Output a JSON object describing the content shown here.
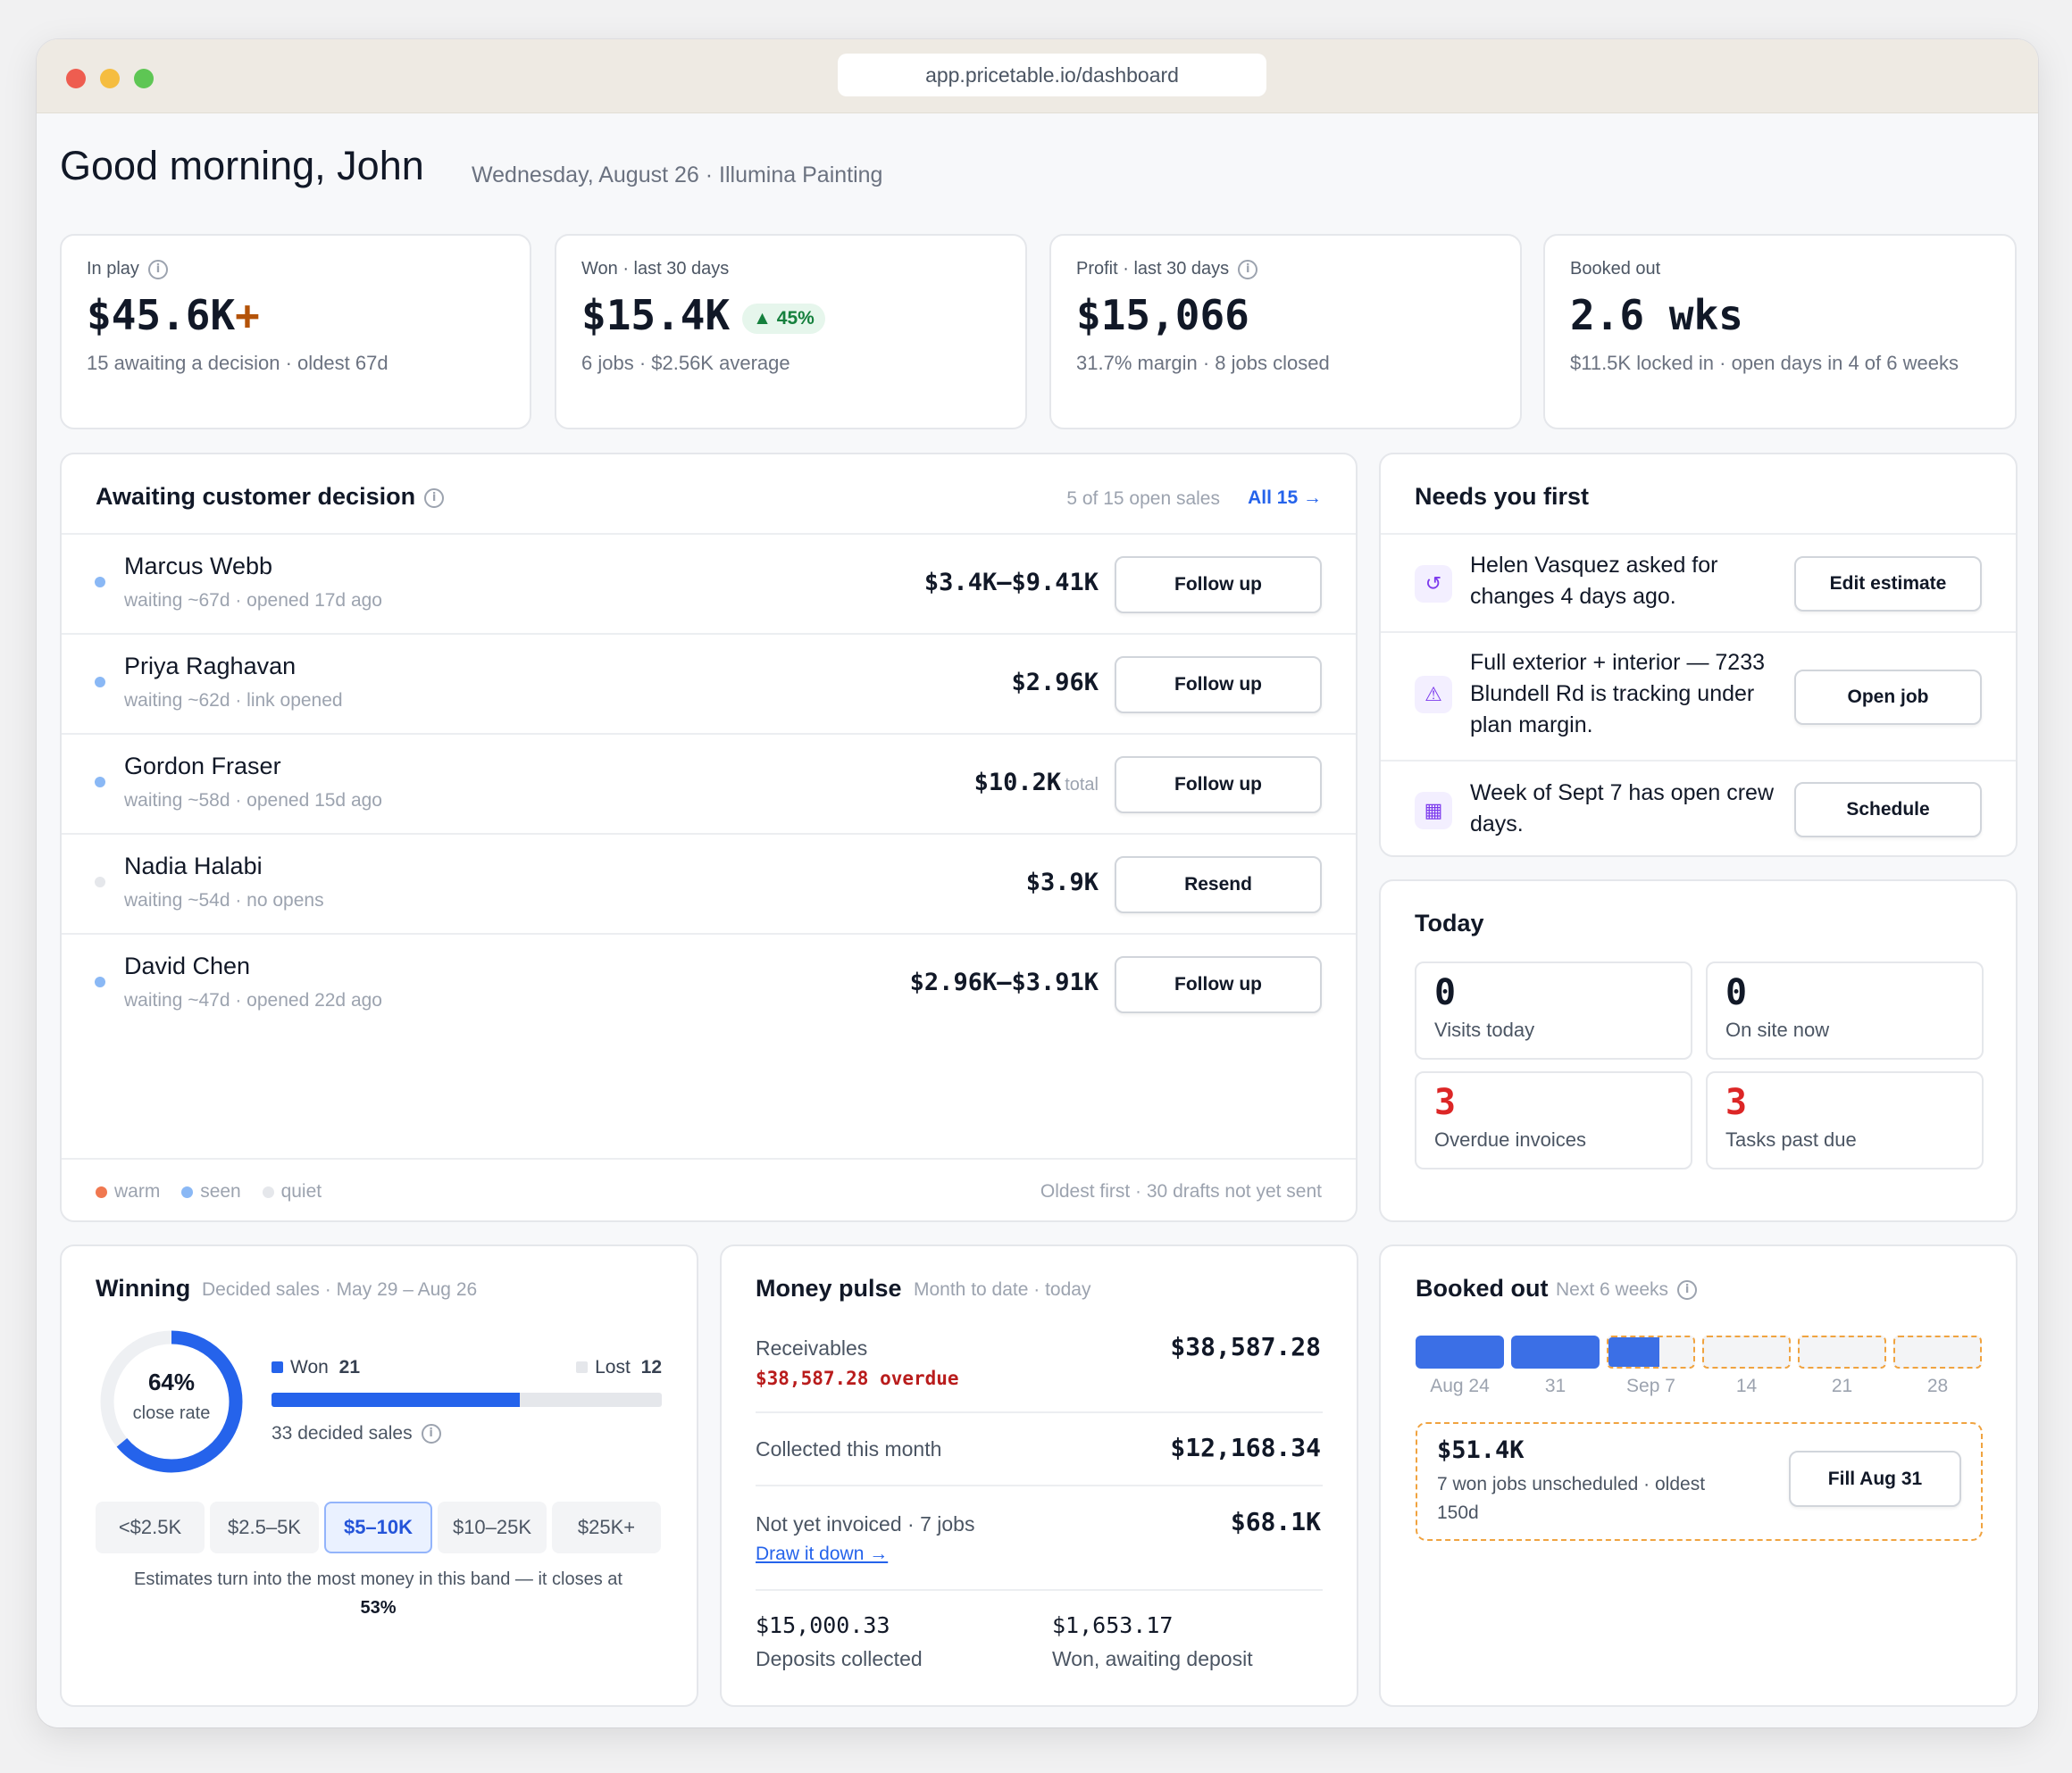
{
  "browser": {
    "url": "app.pricetable.io/dashboard"
  },
  "header": {
    "greeting": "Good morning, John",
    "subtitle": "Wednesday, August 26 · Illumina Painting"
  },
  "stats": {
    "in_play": {
      "label": "In play",
      "value": "$45.6K",
      "plus": "+",
      "sub": "15 awaiting a decision · oldest 67d"
    },
    "won": {
      "label": "Won · last 30 days",
      "value": "$15.4K",
      "badge": "▲ 45%",
      "sub": "6 jobs · $2.56K average"
    },
    "profit": {
      "label": "Profit · last 30 days",
      "value": "$15,066",
      "sub": "31.7% margin · 8 jobs closed"
    },
    "booked": {
      "label": "Booked out",
      "value": "2.6 wks",
      "sub": "$11.5K locked in · open days in 4 of 6 weeks"
    }
  },
  "awaiting": {
    "title": "Awaiting customer decision",
    "count_text": "5 of 15 open sales",
    "all_link": "All 15 →",
    "rows": [
      {
        "name": "Marcus Webb",
        "meta": "waiting ~67d · opened 17d ago",
        "amount": "$3.4K–$9.41K",
        "amount_suffix": "",
        "action": "Follow up",
        "status": "seen"
      },
      {
        "name": "Priya Raghavan",
        "meta": "waiting ~62d · link opened",
        "amount": "$2.96K",
        "amount_suffix": "",
        "action": "Follow up",
        "status": "seen"
      },
      {
        "name": "Gordon Fraser",
        "meta": "waiting ~58d · opened 15d ago",
        "amount": "$10.2K",
        "amount_suffix": "total",
        "action": "Follow up",
        "status": "seen"
      },
      {
        "name": "Nadia Halabi",
        "meta": "waiting ~54d · no opens",
        "amount": "$3.9K",
        "amount_suffix": "",
        "action": "Resend",
        "status": "quiet"
      },
      {
        "name": "David Chen",
        "meta": "waiting ~47d · opened 22d ago",
        "amount": "$2.96K–$3.91K",
        "amount_suffix": "",
        "action": "Follow up",
        "status": "seen"
      }
    ],
    "legend": {
      "warm": "warm",
      "seen": "seen",
      "quiet": "quiet"
    },
    "footer_note": "Oldest first · 30 drafts not yet sent"
  },
  "needs": {
    "title": "Needs you first",
    "items": [
      {
        "icon": "revert-icon",
        "text": "Helen Vasquez asked for changes 4 days ago.",
        "action": "Edit estimate"
      },
      {
        "icon": "warning-icon",
        "text": "Full exterior + interior — 7233 Blundell Rd is tracking under plan margin.",
        "action": "Open job"
      },
      {
        "icon": "calendar-icon",
        "text": "Week of Sept 7 has open crew days.",
        "action": "Schedule"
      }
    ]
  },
  "today": {
    "title": "Today",
    "tiles": [
      {
        "value": "0",
        "label": "Visits today"
      },
      {
        "value": "0",
        "label": "On site now"
      },
      {
        "value": "3",
        "label": "Overdue invoices"
      },
      {
        "value": "3",
        "label": "Tasks past due"
      }
    ]
  },
  "winning": {
    "title": "Winning",
    "subtitle": "Decided sales · May 29 – Aug 26",
    "close_rate": "64%",
    "close_rate_label": "close rate",
    "close_rate_fraction": 0.64,
    "won_label": "Won",
    "won_count": "21",
    "lost_label": "Lost",
    "lost_count": "12",
    "decided": "33 decided sales",
    "bands": [
      "<$2.5K",
      "$2.5–5K",
      "$5–10K",
      "$10–25K",
      "$25K+"
    ],
    "active_band": "$5–10K",
    "note": "Estimates turn into the most money in this band — it closes at",
    "note_value": "53%"
  },
  "money": {
    "title": "Money pulse",
    "subtitle": "Month to date · today",
    "receivables_label": "Receivables",
    "receivables_value": "$38,587.28",
    "receivables_overdue": "$38,587.28 overdue",
    "collected_label": "Collected this month",
    "collected_value": "$12,168.34",
    "not_invoiced_label": "Not yet invoiced · 7 jobs",
    "not_invoiced_value": "$68.1K",
    "draw_link": "Draw it down →",
    "deposits_value": "$15,000.33",
    "deposits_label": "Deposits collected",
    "awaiting_value": "$1,653.17",
    "awaiting_label": "Won, awaiting deposit"
  },
  "booked": {
    "title": "Booked out",
    "subtitle": "Next 6 weeks",
    "weeks": [
      {
        "label": "Aug 24",
        "fill": 1.0
      },
      {
        "label": "31",
        "fill": 1.0
      },
      {
        "label": "Sep 7",
        "fill": 0.6
      },
      {
        "label": "14",
        "fill": 0.0
      },
      {
        "label": "21",
        "fill": 0.0
      },
      {
        "label": "28",
        "fill": 0.0
      }
    ],
    "unscheduled_value": "$51.4K",
    "unscheduled_text": "7 won jobs unscheduled · oldest 150d",
    "action": "Fill Aug 31"
  },
  "colors": {
    "accent": "#2563eb",
    "warm": "#f07850",
    "seen": "#8ab8f5",
    "quiet": "#e5e7eb",
    "danger": "#dc2626",
    "overdue_text": "#b91c1c",
    "in_play_plus": "#b45309",
    "win_badge_bg": "#e6f6ec",
    "win_badge_fg": "#15803d",
    "booked_dashed": "#f0a340"
  }
}
